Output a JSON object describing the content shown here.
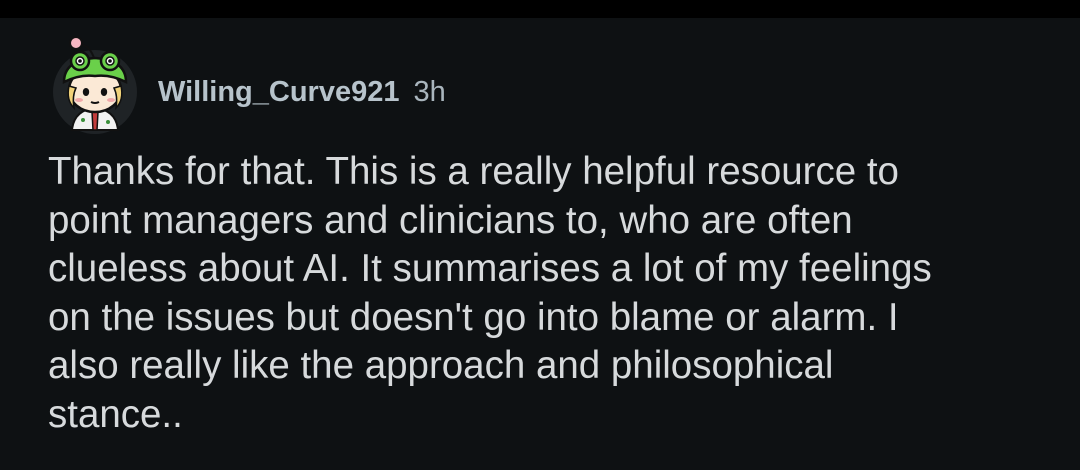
{
  "comment": {
    "author": "Willing_Curve921",
    "age": "3h",
    "avatar_icon": "snoo-frog-hat-avatar-icon",
    "body": "Thanks for that. This is a really helpful resource to\npoint managers and clinicians to, who are often\nclueless about AI. It summarises a lot of my feelings\non the issues but doesn't go into blame or alarm. I\nalso really like the approach and philosophical\nstance.."
  },
  "colors": {
    "background": "#0e1113",
    "text": "#d7dadc",
    "meta_text": "#b7c3cb",
    "avatar_hat": "#6ad04a"
  }
}
